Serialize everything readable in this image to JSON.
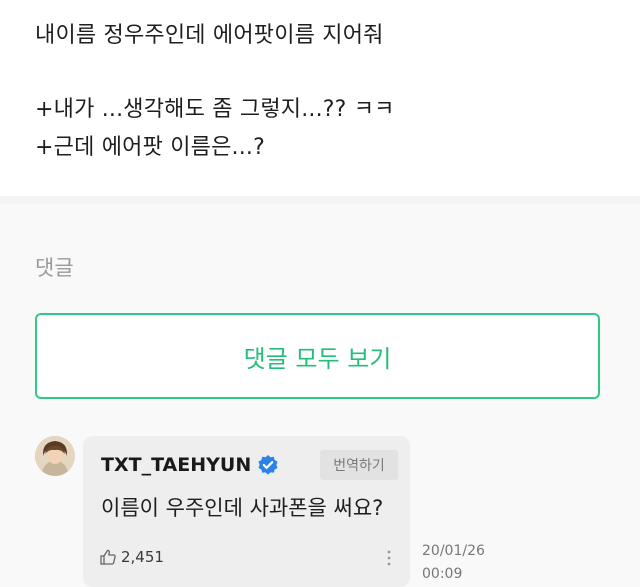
{
  "post": {
    "line1": "내이름 정우주인데 에어팟이름 지어줘",
    "line2": "+내가 ...생각해도 좀 그렇지...?? ㅋㅋ",
    "line3": "+근데 에어팟 이름은...?"
  },
  "comments": {
    "section_label": "댓글",
    "view_all_label": "댓글 모두 보기"
  },
  "comment": {
    "author": "TXT_TAEHYUN",
    "translate_label": "번역하기",
    "text": "이름이 우주인데 사과폰을 써요?",
    "likes": "2,451",
    "date": "20/01/26",
    "time": "00:09"
  },
  "colors": {
    "accent": "#22bf7a",
    "verified": "#2a84e8"
  },
  "icons": [
    "verified-badge-icon",
    "thumbs-up-icon",
    "more-vertical-icon"
  ]
}
